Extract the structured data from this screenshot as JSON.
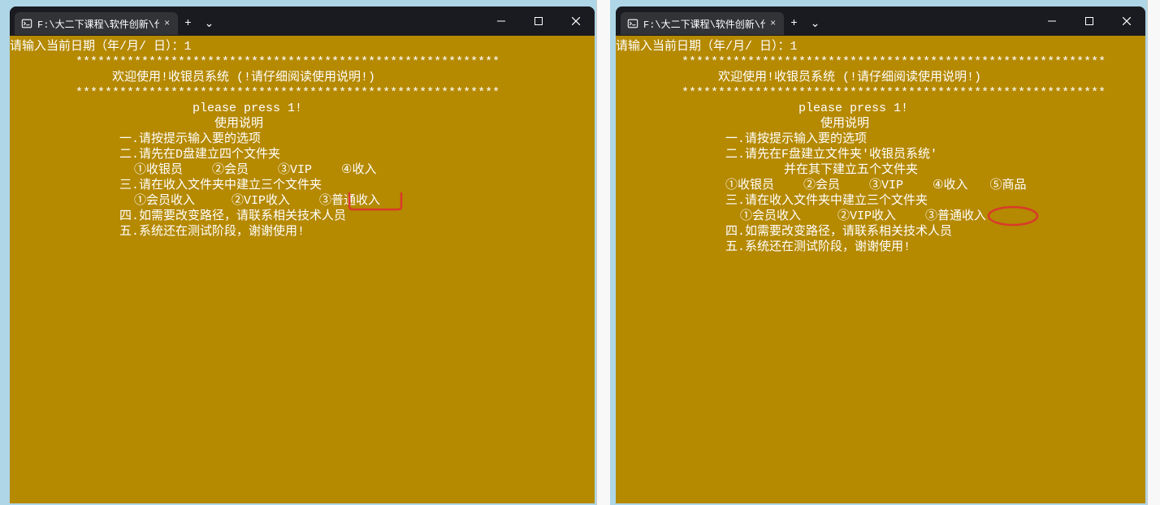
{
  "windows": [
    {
      "id": "left",
      "tab_title": "F:\\大二下课程\\软件创新\\代码\\",
      "console_lines": [
        "请输入当前日期（年/月/ 日）：1",
        "         **********************************************************",
        "              欢迎使用!收银员系统 (!请仔细阅读使用说明!)",
        "         **********************************************************",
        "                         please press 1!",
        "                            使用说明",
        "               一.请按提示输入要的选项",
        "               二.请先在D盘建立四个文件夹",
        "                 ①收银员    ②会员    ③VIP    ④收入",
        "               三.请在收入文件夹中建立三个文件夹",
        "                 ①会员收入     ②VIP收入    ③普通收入",
        "               四.如需要改变路径，请联系相关技术人员",
        "               五.系统还在测试阶段，谢谢使用!"
      ]
    },
    {
      "id": "right",
      "tab_title": "F:\\大二下课程\\软件创新\\代码\\",
      "console_lines": [
        "请输入当前日期（年/月/ 日）：1",
        "         **********************************************************",
        "              欢迎使用!收银员系统 (!请仔细阅读使用说明!)",
        "         **********************************************************",
        "                         please press 1!",
        "                            使用说明",
        "               一.请按提示输入要的选项",
        "               二.请先在F盘建立文件夹'收银员系统'",
        "                       并在其下建立五个文件夹",
        "               ①收银员    ②会员    ③VIP    ④收入   ⑤商品",
        "               三.请在收入文件夹中建立三个文件夹",
        "                 ①会员收入     ②VIP收入    ③普通收入",
        "               四.如需要改变路径，请联系相关技术人员",
        "               五.系统还在测试阶段，谢谢使用!"
      ]
    }
  ],
  "colors": {
    "console_bg": "#b58900",
    "titlebar_bg": "#1a1b20",
    "annotation": "#d93a2b"
  },
  "icons": {
    "terminal": "terminal-icon",
    "close_tab": "×",
    "new_tab": "+",
    "dropdown": "⌄",
    "minimize": "—",
    "maximize": "▢",
    "close_win": "✕"
  }
}
